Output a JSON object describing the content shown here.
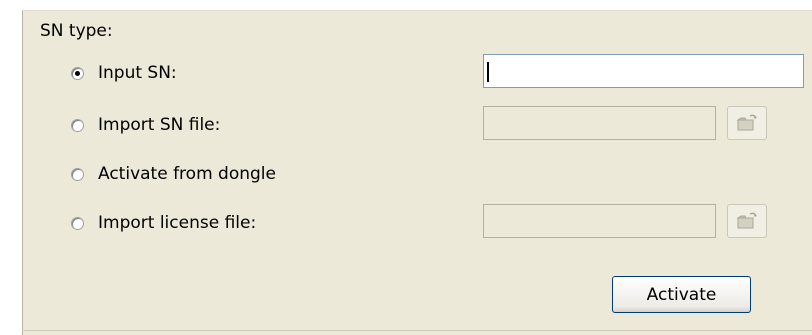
{
  "sn_type": {
    "label": "SN type:",
    "options": [
      {
        "label": "Input SN:",
        "selected": true
      },
      {
        "label": "Import SN file:",
        "selected": false
      },
      {
        "label": "Activate from dongle",
        "selected": false
      },
      {
        "label": "Import license file:",
        "selected": false
      }
    ],
    "sn_input_value": "",
    "sn_file_value": "",
    "license_file_value": "",
    "browse_icon": "folder-open-icon"
  },
  "activate_label": "Activate",
  "colors": {
    "panel_bg": "#ece9d8",
    "disabled_field_border": "#b2b09f",
    "input_border": "#7f9db9",
    "button_border": "#003c74"
  }
}
